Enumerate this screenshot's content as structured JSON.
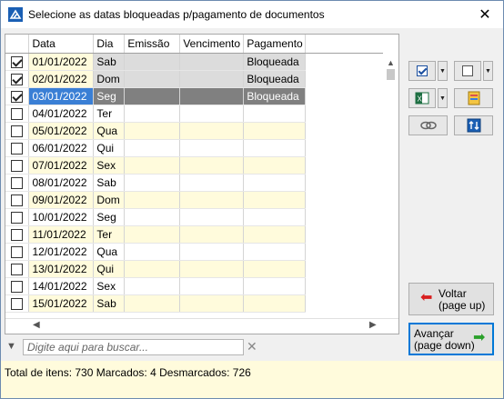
{
  "window": {
    "title": "Selecione as datas bloqueadas p/pagamento de documentos",
    "close_glyph": "✕"
  },
  "grid": {
    "columns": [
      "Data",
      "Dia",
      "Emissão",
      "Vencimento",
      "Pagamento"
    ],
    "rows": [
      {
        "checked": true,
        "date": "01/01/2022",
        "day": "Sab",
        "emissao": "",
        "vencimento": "",
        "pagamento": "Bloqueada",
        "state": "blocked"
      },
      {
        "checked": true,
        "date": "02/01/2022",
        "day": "Dom",
        "emissao": "",
        "vencimento": "",
        "pagamento": "Bloqueada",
        "state": "blocked"
      },
      {
        "checked": true,
        "date": "03/01/2022",
        "day": "Seg",
        "emissao": "",
        "vencimento": "",
        "pagamento": "Bloqueada",
        "state": "selected"
      },
      {
        "checked": false,
        "date": "04/01/2022",
        "day": "Ter",
        "emissao": "",
        "vencimento": "",
        "pagamento": "",
        "state": "even"
      },
      {
        "checked": false,
        "date": "05/01/2022",
        "day": "Qua",
        "emissao": "",
        "vencimento": "",
        "pagamento": "",
        "state": "odd"
      },
      {
        "checked": false,
        "date": "06/01/2022",
        "day": "Qui",
        "emissao": "",
        "vencimento": "",
        "pagamento": "",
        "state": "even"
      },
      {
        "checked": false,
        "date": "07/01/2022",
        "day": "Sex",
        "emissao": "",
        "vencimento": "",
        "pagamento": "",
        "state": "odd"
      },
      {
        "checked": false,
        "date": "08/01/2022",
        "day": "Sab",
        "emissao": "",
        "vencimento": "",
        "pagamento": "",
        "state": "even"
      },
      {
        "checked": false,
        "date": "09/01/2022",
        "day": "Dom",
        "emissao": "",
        "vencimento": "",
        "pagamento": "",
        "state": "odd"
      },
      {
        "checked": false,
        "date": "10/01/2022",
        "day": "Seg",
        "emissao": "",
        "vencimento": "",
        "pagamento": "",
        "state": "even"
      },
      {
        "checked": false,
        "date": "11/01/2022",
        "day": "Ter",
        "emissao": "",
        "vencimento": "",
        "pagamento": "",
        "state": "odd"
      },
      {
        "checked": false,
        "date": "12/01/2022",
        "day": "Qua",
        "emissao": "",
        "vencimento": "",
        "pagamento": "",
        "state": "even"
      },
      {
        "checked": false,
        "date": "13/01/2022",
        "day": "Qui",
        "emissao": "",
        "vencimento": "",
        "pagamento": "",
        "state": "odd"
      },
      {
        "checked": false,
        "date": "14/01/2022",
        "day": "Sex",
        "emissao": "",
        "vencimento": "",
        "pagamento": "",
        "state": "even"
      },
      {
        "checked": false,
        "date": "15/01/2022",
        "day": "Sab",
        "emissao": "",
        "vencimento": "",
        "pagamento": "",
        "state": "odd"
      }
    ]
  },
  "search": {
    "placeholder": "Digite aqui para buscar..."
  },
  "toolbar": {
    "check_all_icon": "check-all-icon",
    "uncheck_all_icon": "uncheck-all-icon",
    "excel_icon": "excel-export-icon",
    "report_icon": "report-icon",
    "link_icon": "link-icon",
    "sort_icon": "sort-icon"
  },
  "nav": {
    "voltar_line1": "Voltar",
    "voltar_line2": "(page up)",
    "avancar_line1": "Avançar",
    "avancar_line2": "(page down)"
  },
  "status": {
    "text": "Total de itens: 730 Marcados: 4 Desmarcados: 726"
  }
}
